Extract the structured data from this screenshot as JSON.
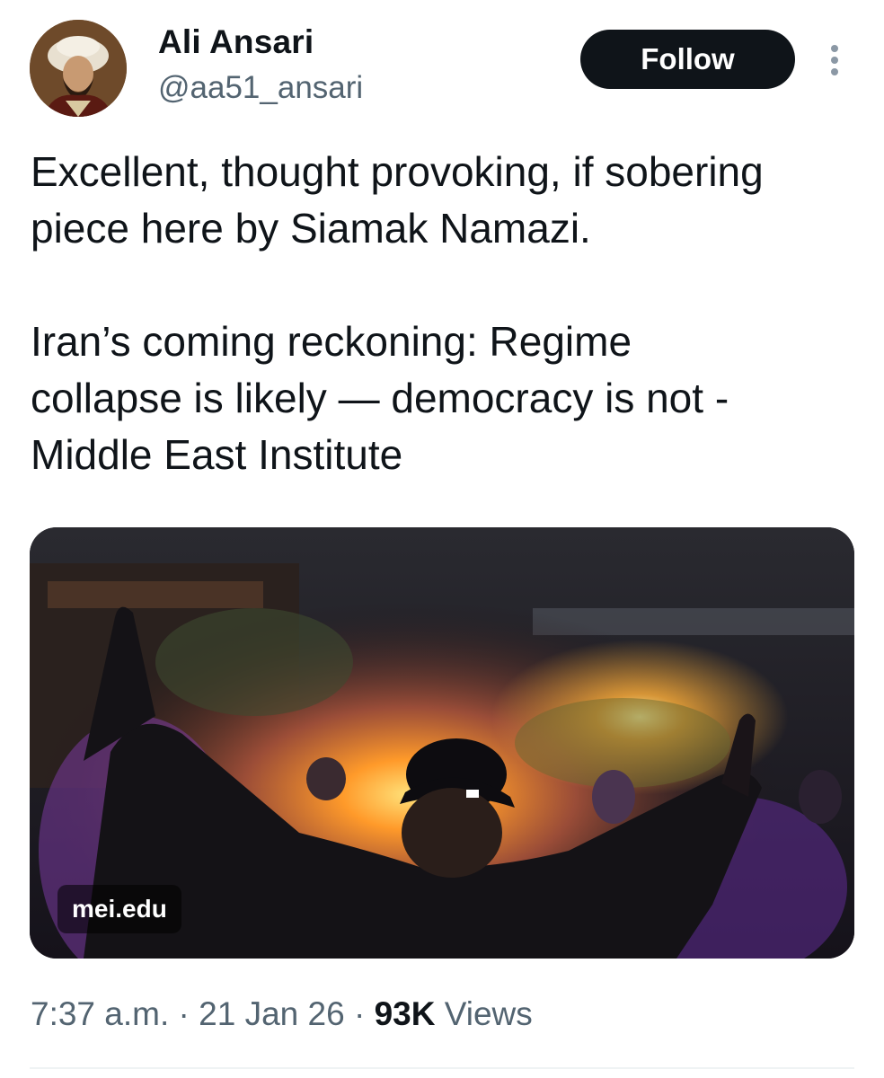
{
  "author": {
    "name": "Ali Ansari",
    "handle": "@aa51_ansari"
  },
  "header": {
    "follow_label": "Follow"
  },
  "tweet": {
    "text": "Excellent, thought provoking, if sobering\npiece here by Siamak Namazi.\n\nIran’s coming reckoning: Regime\ncollapse is likely — democracy is not -\nMiddle East Institute"
  },
  "card": {
    "domain": "mei.edu"
  },
  "meta": {
    "time": "7:37 a.m.",
    "separator": " · ",
    "date": "21 Jan 26",
    "views_count": "93K",
    "views_label": " Views"
  },
  "icons": {
    "more": "more-vertical-icon"
  },
  "colors": {
    "follow_bg": "#0f1419",
    "secondary_text": "#536471",
    "primary_text": "#0f1419"
  }
}
